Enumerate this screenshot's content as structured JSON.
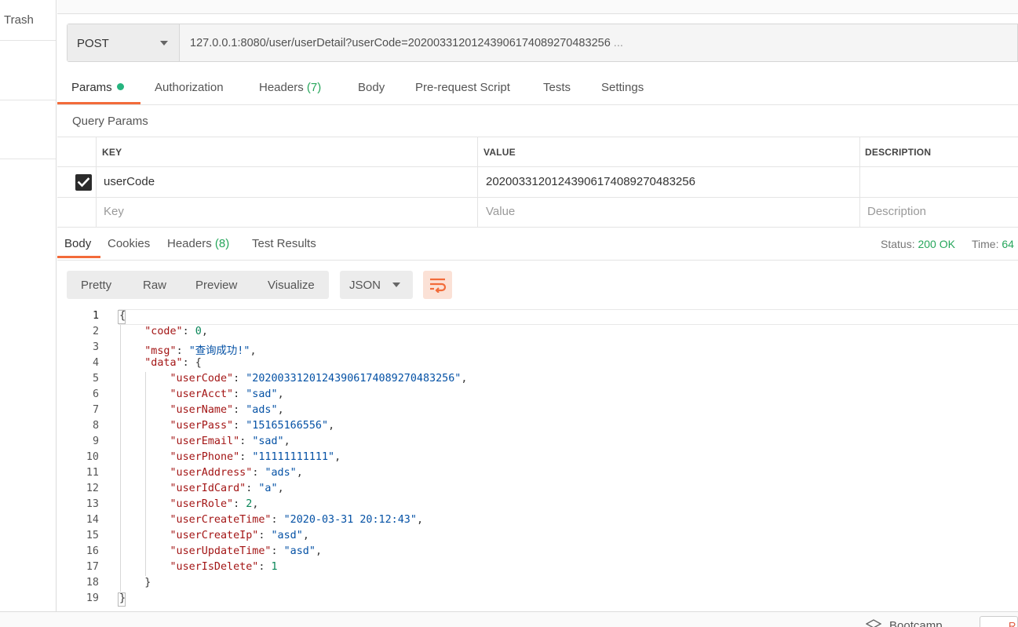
{
  "sidebar": {
    "trash_label": "Trash"
  },
  "request": {
    "method": "POST",
    "url": "127.0.0.1:8080/user/userDetail?userCode=20200331201243906174089270483256",
    "url_ellipsis": "..."
  },
  "request_tabs": {
    "params": "Params",
    "authorization": "Authorization",
    "headers": "Headers",
    "headers_count": "(7)",
    "body": "Body",
    "pre_request": "Pre-request Script",
    "tests": "Tests",
    "settings": "Settings"
  },
  "query_params": {
    "title": "Query Params",
    "headers": {
      "key": "KEY",
      "value": "VALUE",
      "description": "DESCRIPTION"
    },
    "rows": [
      {
        "key": "userCode",
        "value": "20200331201243906174089270483256",
        "checked": true
      }
    ],
    "placeholders": {
      "key": "Key",
      "value": "Value",
      "description": "Description"
    }
  },
  "response_tabs": {
    "body": "Body",
    "cookies": "Cookies",
    "headers": "Headers",
    "headers_count": "(8)",
    "test_results": "Test Results"
  },
  "response_status": {
    "status_label": "Status:",
    "status_value": "200 OK",
    "time_label": "Time:",
    "time_value": "64"
  },
  "response_view": {
    "pretty": "Pretty",
    "raw": "Raw",
    "preview": "Preview",
    "visualize": "Visualize",
    "format": "JSON"
  },
  "code_lines": [
    {
      "n": "1",
      "parts": [
        [
          "p",
          "{"
        ]
      ]
    },
    {
      "n": "2",
      "parts": [
        [
          "p",
          "    "
        ],
        [
          "k",
          "\"code\""
        ],
        [
          "p",
          ": "
        ],
        [
          "n",
          "0"
        ],
        [
          "p",
          ","
        ]
      ]
    },
    {
      "n": "3",
      "parts": [
        [
          "p",
          "    "
        ],
        [
          "k",
          "\"msg\""
        ],
        [
          "p",
          ": "
        ],
        [
          "s",
          "\"查询成功!\""
        ],
        [
          "p",
          ","
        ]
      ]
    },
    {
      "n": "4",
      "parts": [
        [
          "p",
          "    "
        ],
        [
          "k",
          "\"data\""
        ],
        [
          "p",
          ": {"
        ]
      ]
    },
    {
      "n": "5",
      "parts": [
        [
          "p",
          "        "
        ],
        [
          "k",
          "\"userCode\""
        ],
        [
          "p",
          ": "
        ],
        [
          "s",
          "\"20200331201243906174089270483256\""
        ],
        [
          "p",
          ","
        ]
      ]
    },
    {
      "n": "6",
      "parts": [
        [
          "p",
          "        "
        ],
        [
          "k",
          "\"userAcct\""
        ],
        [
          "p",
          ": "
        ],
        [
          "s",
          "\"sad\""
        ],
        [
          "p",
          ","
        ]
      ]
    },
    {
      "n": "7",
      "parts": [
        [
          "p",
          "        "
        ],
        [
          "k",
          "\"userName\""
        ],
        [
          "p",
          ": "
        ],
        [
          "s",
          "\"ads\""
        ],
        [
          "p",
          ","
        ]
      ]
    },
    {
      "n": "8",
      "parts": [
        [
          "p",
          "        "
        ],
        [
          "k",
          "\"userPass\""
        ],
        [
          "p",
          ": "
        ],
        [
          "s",
          "\"15165166556\""
        ],
        [
          "p",
          ","
        ]
      ]
    },
    {
      "n": "9",
      "parts": [
        [
          "p",
          "        "
        ],
        [
          "k",
          "\"userEmail\""
        ],
        [
          "p",
          ": "
        ],
        [
          "s",
          "\"sad\""
        ],
        [
          "p",
          ","
        ]
      ]
    },
    {
      "n": "10",
      "parts": [
        [
          "p",
          "        "
        ],
        [
          "k",
          "\"userPhone\""
        ],
        [
          "p",
          ": "
        ],
        [
          "s",
          "\"11111111111\""
        ],
        [
          "p",
          ","
        ]
      ]
    },
    {
      "n": "11",
      "parts": [
        [
          "p",
          "        "
        ],
        [
          "k",
          "\"userAddress\""
        ],
        [
          "p",
          ": "
        ],
        [
          "s",
          "\"ads\""
        ],
        [
          "p",
          ","
        ]
      ]
    },
    {
      "n": "12",
      "parts": [
        [
          "p",
          "        "
        ],
        [
          "k",
          "\"userIdCard\""
        ],
        [
          "p",
          ": "
        ],
        [
          "s",
          "\"a\""
        ],
        [
          "p",
          ","
        ]
      ]
    },
    {
      "n": "13",
      "parts": [
        [
          "p",
          "        "
        ],
        [
          "k",
          "\"userRole\""
        ],
        [
          "p",
          ": "
        ],
        [
          "n",
          "2"
        ],
        [
          "p",
          ","
        ]
      ]
    },
    {
      "n": "14",
      "parts": [
        [
          "p",
          "        "
        ],
        [
          "k",
          "\"userCreateTime\""
        ],
        [
          "p",
          ": "
        ],
        [
          "s",
          "\"2020-03-31 20:12:43\""
        ],
        [
          "p",
          ","
        ]
      ]
    },
    {
      "n": "15",
      "parts": [
        [
          "p",
          "        "
        ],
        [
          "k",
          "\"userCreateIp\""
        ],
        [
          "p",
          ": "
        ],
        [
          "s",
          "\"asd\""
        ],
        [
          "p",
          ","
        ]
      ]
    },
    {
      "n": "16",
      "parts": [
        [
          "p",
          "        "
        ],
        [
          "k",
          "\"userUpdateTime\""
        ],
        [
          "p",
          ": "
        ],
        [
          "s",
          "\"asd\""
        ],
        [
          "p",
          ","
        ]
      ]
    },
    {
      "n": "17",
      "parts": [
        [
          "p",
          "        "
        ],
        [
          "k",
          "\"userIsDelete\""
        ],
        [
          "p",
          ": "
        ],
        [
          "n",
          "1"
        ]
      ]
    },
    {
      "n": "18",
      "parts": [
        [
          "p",
          "    }"
        ]
      ]
    },
    {
      "n": "19",
      "parts": [
        [
          "p",
          "}"
        ]
      ]
    }
  ],
  "footer": {
    "bootcamp": "Bootcamp",
    "edge_tab": "R"
  },
  "icons": {
    "checkbox": "check-icon",
    "wrap": "wrap-lines-icon",
    "bootcamp": "bootcamp-icon"
  },
  "colors": {
    "accent": "#f26b3a",
    "success": "#26a65b",
    "json_key": "#a31515",
    "json_string": "#0451a5",
    "json_number": "#098658"
  }
}
